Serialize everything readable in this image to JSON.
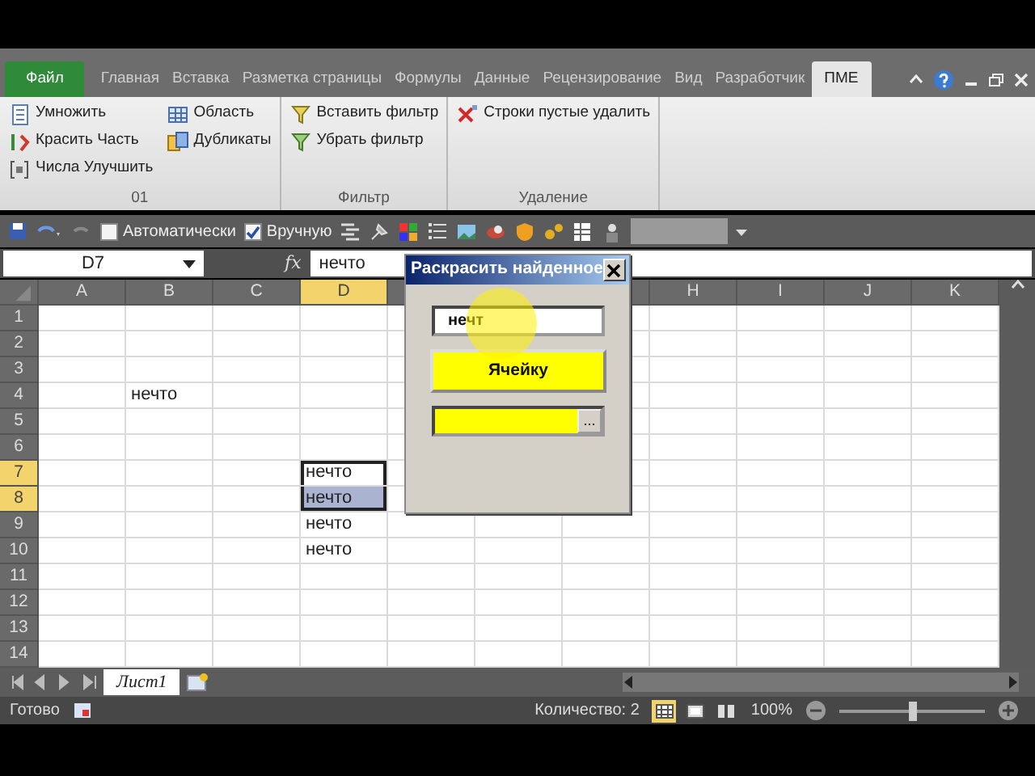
{
  "ribbon": {
    "tabs": [
      {
        "label": "Файл",
        "kind": "file",
        "selected": false
      },
      {
        "label": "Главная",
        "kind": "tab",
        "selected": false
      },
      {
        "label": "Вставка",
        "kind": "tab",
        "selected": false
      },
      {
        "label": "Разметка страницы",
        "kind": "tab",
        "selected": false
      },
      {
        "label": "Формулы",
        "kind": "tab",
        "selected": false
      },
      {
        "label": "Данные",
        "kind": "tab",
        "selected": false
      },
      {
        "label": "Рецензирование",
        "kind": "tab",
        "selected": false
      },
      {
        "label": "Вид",
        "kind": "tab",
        "selected": false
      },
      {
        "label": "Разработчик",
        "kind": "tab",
        "selected": false
      },
      {
        "label": "ПМЕ",
        "kind": "tab",
        "selected": true
      }
    ],
    "groups": [
      {
        "label": "01",
        "columns": [
          [
            "Умножить",
            "Красить Часть",
            "Числа Улучшить"
          ],
          [
            "Область",
            "Дубликаты"
          ]
        ]
      },
      {
        "label": "Фильтр",
        "columns": [
          [
            "Вставить фильтр",
            "Убрать фильтр"
          ]
        ]
      },
      {
        "label": "Удаление",
        "columns": [
          [
            "Строки пустые удалить"
          ]
        ]
      }
    ]
  },
  "quick_access": {
    "calc_options": [
      {
        "label": "Автоматически",
        "checked": false
      },
      {
        "label": "Вручную",
        "checked": true
      }
    ]
  },
  "formula_bar": {
    "name_box": "D7",
    "function_label": "fx",
    "formula": "нечто"
  },
  "sheet": {
    "columns": [
      {
        "label": "A",
        "selected": false
      },
      {
        "label": "B",
        "selected": false
      },
      {
        "label": "C",
        "selected": false
      },
      {
        "label": "D",
        "selected": true
      },
      null,
      null,
      null,
      {
        "label": "H",
        "selected": false
      },
      {
        "label": "I",
        "selected": false
      },
      {
        "label": "J",
        "selected": false
      },
      {
        "label": "K",
        "selected": false
      }
    ],
    "rows": [
      {
        "label": "1",
        "selected": false,
        "cells": [
          null,
          null,
          null,
          null,
          null,
          null,
          null,
          null,
          null,
          null,
          null
        ]
      },
      {
        "label": "2",
        "selected": false,
        "cells": [
          null,
          null,
          null,
          null,
          null,
          null,
          null,
          null,
          null,
          null,
          null
        ]
      },
      {
        "label": "3",
        "selected": false,
        "cells": [
          null,
          null,
          null,
          null,
          null,
          null,
          null,
          null,
          null,
          null,
          null
        ]
      },
      {
        "label": "4",
        "selected": false,
        "cells": [
          null,
          {
            "text": "нечто",
            "active": false,
            "selected": false
          },
          null,
          null,
          null,
          null,
          null,
          null,
          null,
          null,
          null
        ]
      },
      {
        "label": "5",
        "selected": false,
        "cells": [
          null,
          null,
          null,
          null,
          null,
          null,
          null,
          null,
          null,
          null,
          null
        ]
      },
      {
        "label": "6",
        "selected": false,
        "cells": [
          null,
          null,
          null,
          null,
          null,
          null,
          null,
          null,
          null,
          null,
          null
        ]
      },
      {
        "label": "7",
        "selected": true,
        "cells": [
          null,
          null,
          null,
          {
            "text": "нечто",
            "active": true,
            "selected": false
          },
          null,
          null,
          null,
          null,
          null,
          null,
          null
        ]
      },
      {
        "label": "8",
        "selected": true,
        "cells": [
          null,
          null,
          null,
          {
            "text": "нечто",
            "active": false,
            "selected": true
          },
          null,
          null,
          null,
          null,
          null,
          null,
          null
        ]
      },
      {
        "label": "9",
        "selected": false,
        "cells": [
          null,
          null,
          null,
          {
            "text": "нечто",
            "active": false,
            "selected": false
          },
          null,
          null,
          null,
          null,
          null,
          null,
          null
        ]
      },
      {
        "label": "10",
        "selected": false,
        "cells": [
          null,
          null,
          null,
          {
            "text": "нечто",
            "active": false,
            "selected": false
          },
          null,
          null,
          null,
          null,
          null,
          null,
          null
        ]
      },
      {
        "label": "11",
        "selected": false,
        "cells": [
          null,
          null,
          null,
          null,
          null,
          null,
          null,
          null,
          null,
          null,
          null
        ]
      },
      {
        "label": "12",
        "selected": false,
        "cells": [
          null,
          null,
          null,
          null,
          null,
          null,
          null,
          null,
          null,
          null,
          null
        ]
      },
      {
        "label": "13",
        "selected": false,
        "cells": [
          null,
          null,
          null,
          null,
          null,
          null,
          null,
          null,
          null,
          null,
          null
        ]
      },
      {
        "label": "14",
        "selected": false,
        "cells": [
          null,
          null,
          null,
          null,
          null,
          null,
          null,
          null,
          null,
          null,
          null
        ]
      }
    ]
  },
  "sheet_tabs": [
    {
      "label": "Лист1",
      "selected": true
    }
  ],
  "status_bar": {
    "status": "Готово",
    "summary": "Количество: 2",
    "views": [
      {
        "kind": "normal",
        "selected": true
      },
      {
        "kind": "layout",
        "selected": false
      },
      {
        "kind": "page_break",
        "selected": false
      }
    ],
    "zoom": "100%",
    "zoom_slider": {
      "level": 0.5
    }
  },
  "dialog": {
    "title": "Раскрасить найденное",
    "search": {
      "value": "нечт"
    },
    "button": "Ячейку",
    "color_field": {
      "browse": "..."
    }
  }
}
